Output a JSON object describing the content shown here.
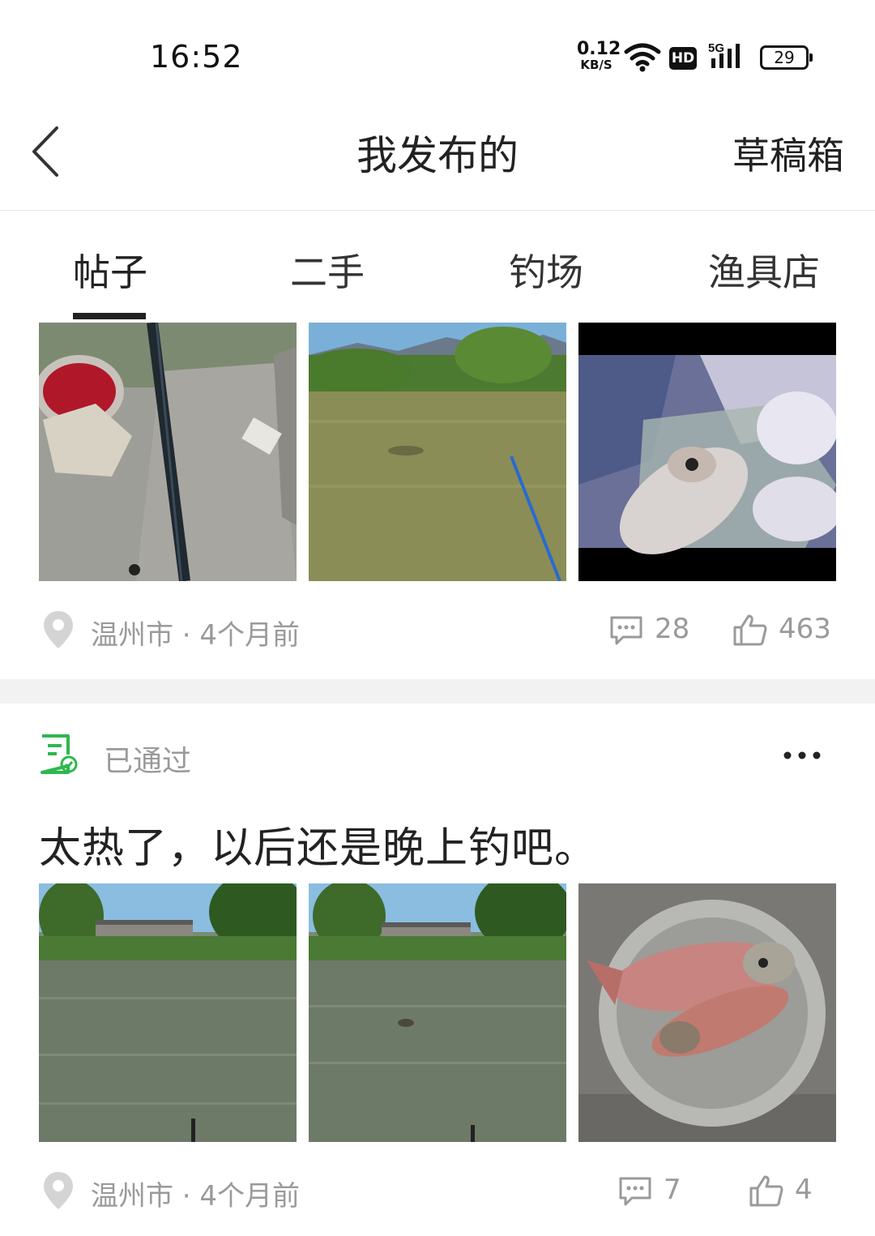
{
  "status_bar": {
    "time": "16:52",
    "net_speed_value": "0.12",
    "net_speed_unit": "KB/S",
    "hd_label": "HD",
    "network_label": "5G",
    "battery": "29"
  },
  "header": {
    "title": "我发布的",
    "drafts_label": "草稿箱",
    "back_icon": "chevron-left-icon"
  },
  "tabs": [
    {
      "label": "帖子",
      "active": true
    },
    {
      "label": "二手",
      "active": false
    },
    {
      "label": "钓场",
      "active": false
    },
    {
      "label": "渔具店",
      "active": false
    }
  ],
  "posts": [
    {
      "images": [
        "fishing-rod-on-stone-photo",
        "river-with-rod-photo",
        "fish-in-net-photo"
      ],
      "location": "温州市 · 4个月前",
      "comments": "28",
      "likes": "463"
    },
    {
      "status": "已通过",
      "text": "太热了，以后还是晚上钓吧。",
      "images": [
        "river-bank-photo",
        "river-bank-photo-2",
        "fish-in-basin-photo"
      ],
      "location": "温州市 · 4个月前",
      "comments": "7",
      "likes": "4"
    }
  ],
  "colors": {
    "accent_green": "#2db84d",
    "muted_text": "#9a9a9a",
    "divider": "#f2f2f2"
  }
}
